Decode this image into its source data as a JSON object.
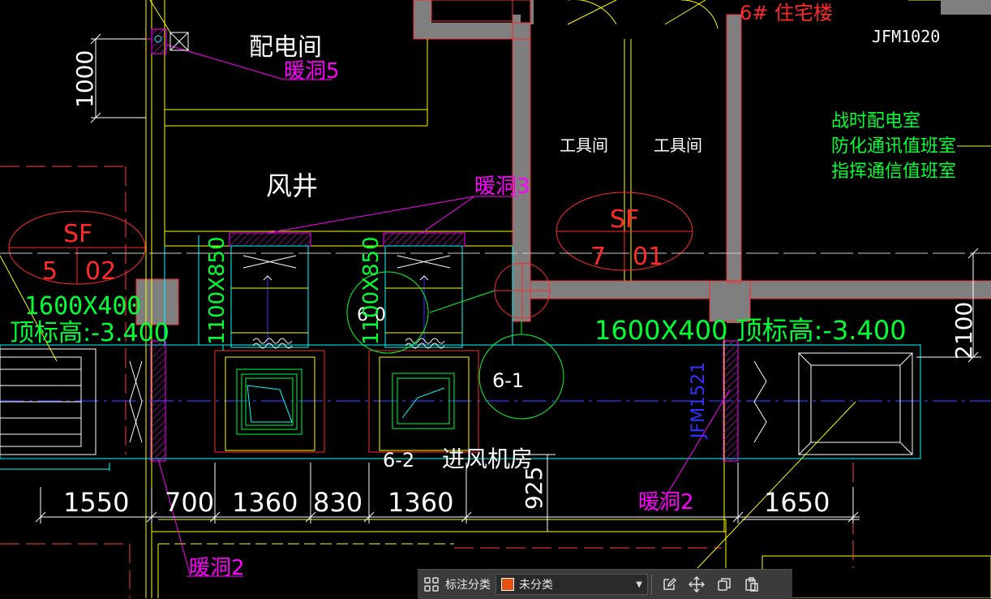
{
  "colors": {
    "wall": "#7f7f7f",
    "yellow": "#ffff00",
    "green": "#00ff33",
    "cyan": "#00ffff",
    "magenta": "#ff00ff",
    "red": "#ff2a2a",
    "blue": "#3333ff",
    "white": "#ffffff",
    "accent_swatch": "#e8500f"
  },
  "rooms": {
    "distribution_room": "配电间",
    "air_shaft": "风井",
    "tool_room_1": "工具间",
    "tool_room_2": "工具间",
    "building_label": "6# 住宅楼",
    "wartime_list": [
      "战时配电室",
      "防化通讯值班室",
      "指挥通信值班室"
    ],
    "intake_room": "进风机房",
    "intake_prefix": "6-2"
  },
  "door_tags": {
    "jfm1020": "JFM1020",
    "jfm1521": "JFM1521"
  },
  "openings": {
    "hole5": "暖洞5",
    "hole3": "暖洞3",
    "hole2_right": "暖洞2",
    "hole2_left": "暖洞2"
  },
  "equipment": {
    "sf_left": {
      "top": "SF",
      "bottom_left": "5",
      "bottom_right": "02"
    },
    "sf_right": {
      "top": "SF",
      "bottom_left": "7",
      "bottom_right": "01"
    },
    "tag_6_0": "6-0",
    "tag_6_1": "6-1"
  },
  "ducts": {
    "left_size": "1600X400",
    "left_elev": "顶标高:-3.400",
    "right_label": "1600X400 顶标高:-3.400",
    "vert_1": "1100X850",
    "vert_2": "1100X850"
  },
  "dimensions": {
    "d1000": "1000",
    "d2100": "2100",
    "d925": "925",
    "bottom": [
      "1550",
      "700",
      "1360",
      "830",
      "1360"
    ],
    "d1650": "1650"
  },
  "toolbar": {
    "category_label": "标注分类",
    "dropdown_value": "未分类",
    "icons": [
      "apps-grid-icon",
      "edit-icon",
      "move-icon",
      "copy-icon",
      "paste-icon"
    ]
  }
}
